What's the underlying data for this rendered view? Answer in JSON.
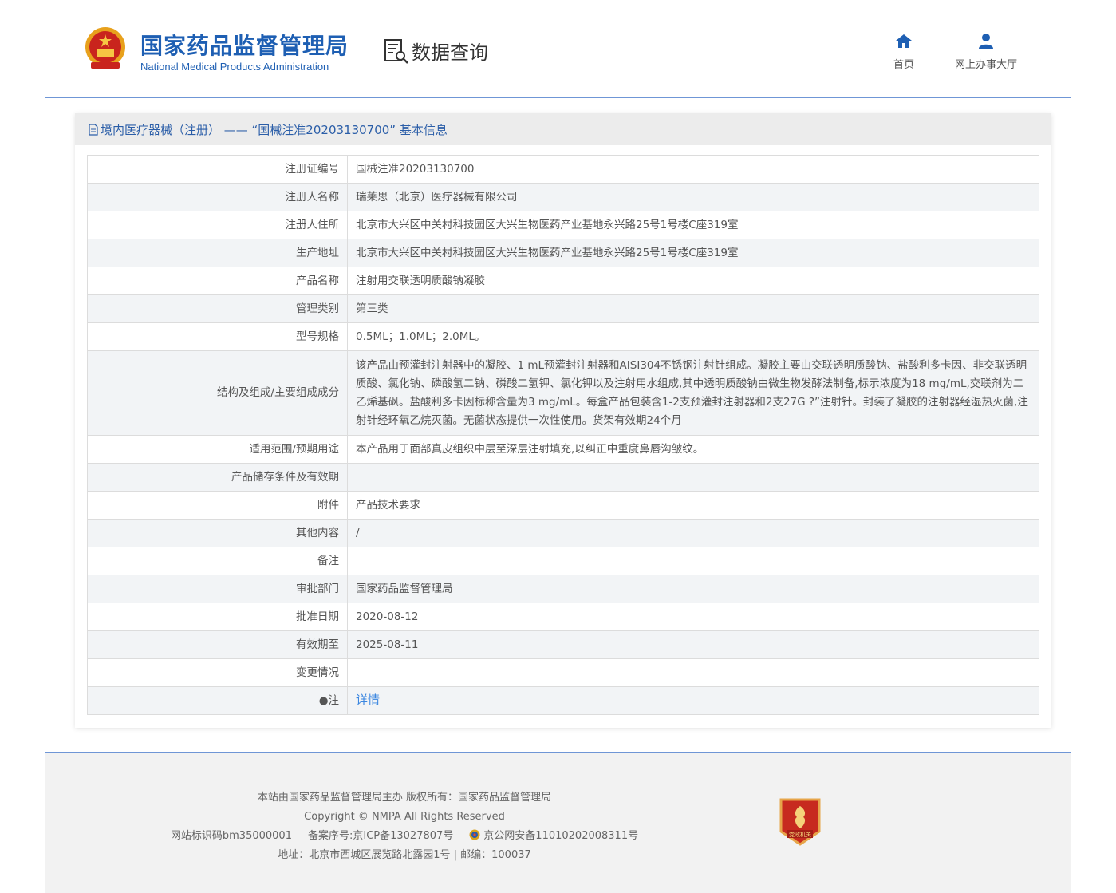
{
  "header": {
    "brand_cn": "国家药品监督管理局",
    "brand_en": "National Medical Products Administration",
    "data_query": "数据查询",
    "nav_home": "首页",
    "nav_service": "网上办事大厅",
    "accent_color": "#1e5fb3"
  },
  "panel": {
    "title": "境内医疗器械（注册） —— “国械注准20203130700” 基本信息"
  },
  "rows": [
    {
      "label": "注册证编号",
      "value": "国械注准20203130700"
    },
    {
      "label": "注册人名称",
      "value": "瑞莱思（北京）医疗器械有限公司"
    },
    {
      "label": "注册人住所",
      "value": "北京市大兴区中关村科技园区大兴生物医药产业基地永兴路25号1号楼C座319室"
    },
    {
      "label": "生产地址",
      "value": "北京市大兴区中关村科技园区大兴生物医药产业基地永兴路25号1号楼C座319室"
    },
    {
      "label": "产品名称",
      "value": "注射用交联透明质酸钠凝胶"
    },
    {
      "label": "管理类别",
      "value": "第三类"
    },
    {
      "label": "型号规格",
      "value": "0.5ML；1.0ML；2.0ML。"
    },
    {
      "label": "结构及组成/主要组成成分",
      "value": "该产品由预灌封注射器中的凝胶、1 mL预灌封注射器和AISI304不锈钢注射针组成。凝胶主要由交联透明质酸钠、盐酸利多卡因、非交联透明质酸、氯化钠、磷酸氢二钠、磷酸二氢钾、氯化钾以及注射用水组成,其中透明质酸钠由微生物发酵法制备,标示浓度为18 mg/mL,交联剂为二乙烯基砜。盐酸利多卡因标称含量为3 mg/mL。每盒产品包装含1-2支预灌封注射器和2支27G ?”注射针。封装了凝胶的注射器经湿热灭菌,注射针经环氧乙烷灭菌。无菌状态提供一次性使用。货架有效期24个月"
    },
    {
      "label": "适用范围/预期用途",
      "value": "本产品用于面部真皮组织中层至深层注射填充,以纠正中重度鼻唇沟皱纹。"
    },
    {
      "label": "产品储存条件及有效期",
      "value": ""
    },
    {
      "label": "附件",
      "value": "产品技术要求"
    },
    {
      "label": "其他内容",
      "value": "/"
    },
    {
      "label": "备注",
      "value": ""
    },
    {
      "label": "审批部门",
      "value": "国家药品监督管理局"
    },
    {
      "label": "批准日期",
      "value": "2020-08-12"
    },
    {
      "label": "有效期至",
      "value": "2025-08-11"
    },
    {
      "label": "变更情况",
      "value": ""
    },
    {
      "label": "●注",
      "value": "详情"
    }
  ],
  "footer": {
    "line1": "本站由国家药品监督管理局主办 版权所有：国家药品监督管理局",
    "line2": "Copyright © NMPA All Rights Reserved",
    "site_id": "网站标识码bm35000001",
    "icp": "备案序号:京ICP备13027807号",
    "police": "京公网安备11010202008311号",
    "address": "地址：北京市西城区展览路北露园1号 | 邮编：100037",
    "badge_text": "党政机关"
  }
}
